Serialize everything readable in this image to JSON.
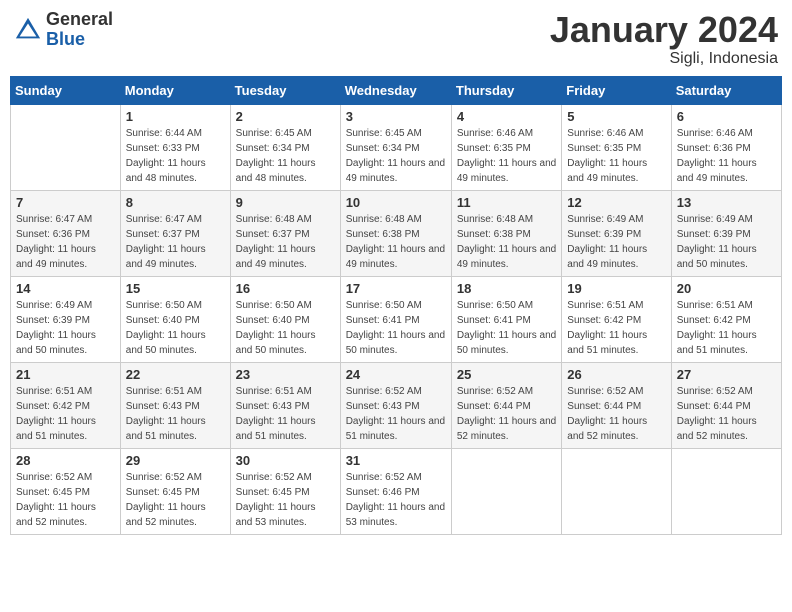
{
  "header": {
    "logo_general": "General",
    "logo_blue": "Blue",
    "month_year": "January 2024",
    "location": "Sigli, Indonesia"
  },
  "weekdays": [
    "Sunday",
    "Monday",
    "Tuesday",
    "Wednesday",
    "Thursday",
    "Friday",
    "Saturday"
  ],
  "weeks": [
    [
      {
        "day": "",
        "sunrise": "",
        "sunset": "",
        "daylight": ""
      },
      {
        "day": "1",
        "sunrise": "Sunrise: 6:44 AM",
        "sunset": "Sunset: 6:33 PM",
        "daylight": "Daylight: 11 hours and 48 minutes."
      },
      {
        "day": "2",
        "sunrise": "Sunrise: 6:45 AM",
        "sunset": "Sunset: 6:34 PM",
        "daylight": "Daylight: 11 hours and 48 minutes."
      },
      {
        "day": "3",
        "sunrise": "Sunrise: 6:45 AM",
        "sunset": "Sunset: 6:34 PM",
        "daylight": "Daylight: 11 hours and 49 minutes."
      },
      {
        "day": "4",
        "sunrise": "Sunrise: 6:46 AM",
        "sunset": "Sunset: 6:35 PM",
        "daylight": "Daylight: 11 hours and 49 minutes."
      },
      {
        "day": "5",
        "sunrise": "Sunrise: 6:46 AM",
        "sunset": "Sunset: 6:35 PM",
        "daylight": "Daylight: 11 hours and 49 minutes."
      },
      {
        "day": "6",
        "sunrise": "Sunrise: 6:46 AM",
        "sunset": "Sunset: 6:36 PM",
        "daylight": "Daylight: 11 hours and 49 minutes."
      }
    ],
    [
      {
        "day": "7",
        "sunrise": "Sunrise: 6:47 AM",
        "sunset": "Sunset: 6:36 PM",
        "daylight": "Daylight: 11 hours and 49 minutes."
      },
      {
        "day": "8",
        "sunrise": "Sunrise: 6:47 AM",
        "sunset": "Sunset: 6:37 PM",
        "daylight": "Daylight: 11 hours and 49 minutes."
      },
      {
        "day": "9",
        "sunrise": "Sunrise: 6:48 AM",
        "sunset": "Sunset: 6:37 PM",
        "daylight": "Daylight: 11 hours and 49 minutes."
      },
      {
        "day": "10",
        "sunrise": "Sunrise: 6:48 AM",
        "sunset": "Sunset: 6:38 PM",
        "daylight": "Daylight: 11 hours and 49 minutes."
      },
      {
        "day": "11",
        "sunrise": "Sunrise: 6:48 AM",
        "sunset": "Sunset: 6:38 PM",
        "daylight": "Daylight: 11 hours and 49 minutes."
      },
      {
        "day": "12",
        "sunrise": "Sunrise: 6:49 AM",
        "sunset": "Sunset: 6:39 PM",
        "daylight": "Daylight: 11 hours and 49 minutes."
      },
      {
        "day": "13",
        "sunrise": "Sunrise: 6:49 AM",
        "sunset": "Sunset: 6:39 PM",
        "daylight": "Daylight: 11 hours and 50 minutes."
      }
    ],
    [
      {
        "day": "14",
        "sunrise": "Sunrise: 6:49 AM",
        "sunset": "Sunset: 6:39 PM",
        "daylight": "Daylight: 11 hours and 50 minutes."
      },
      {
        "day": "15",
        "sunrise": "Sunrise: 6:50 AM",
        "sunset": "Sunset: 6:40 PM",
        "daylight": "Daylight: 11 hours and 50 minutes."
      },
      {
        "day": "16",
        "sunrise": "Sunrise: 6:50 AM",
        "sunset": "Sunset: 6:40 PM",
        "daylight": "Daylight: 11 hours and 50 minutes."
      },
      {
        "day": "17",
        "sunrise": "Sunrise: 6:50 AM",
        "sunset": "Sunset: 6:41 PM",
        "daylight": "Daylight: 11 hours and 50 minutes."
      },
      {
        "day": "18",
        "sunrise": "Sunrise: 6:50 AM",
        "sunset": "Sunset: 6:41 PM",
        "daylight": "Daylight: 11 hours and 50 minutes."
      },
      {
        "day": "19",
        "sunrise": "Sunrise: 6:51 AM",
        "sunset": "Sunset: 6:42 PM",
        "daylight": "Daylight: 11 hours and 51 minutes."
      },
      {
        "day": "20",
        "sunrise": "Sunrise: 6:51 AM",
        "sunset": "Sunset: 6:42 PM",
        "daylight": "Daylight: 11 hours and 51 minutes."
      }
    ],
    [
      {
        "day": "21",
        "sunrise": "Sunrise: 6:51 AM",
        "sunset": "Sunset: 6:42 PM",
        "daylight": "Daylight: 11 hours and 51 minutes."
      },
      {
        "day": "22",
        "sunrise": "Sunrise: 6:51 AM",
        "sunset": "Sunset: 6:43 PM",
        "daylight": "Daylight: 11 hours and 51 minutes."
      },
      {
        "day": "23",
        "sunrise": "Sunrise: 6:51 AM",
        "sunset": "Sunset: 6:43 PM",
        "daylight": "Daylight: 11 hours and 51 minutes."
      },
      {
        "day": "24",
        "sunrise": "Sunrise: 6:52 AM",
        "sunset": "Sunset: 6:43 PM",
        "daylight": "Daylight: 11 hours and 51 minutes."
      },
      {
        "day": "25",
        "sunrise": "Sunrise: 6:52 AM",
        "sunset": "Sunset: 6:44 PM",
        "daylight": "Daylight: 11 hours and 52 minutes."
      },
      {
        "day": "26",
        "sunrise": "Sunrise: 6:52 AM",
        "sunset": "Sunset: 6:44 PM",
        "daylight": "Daylight: 11 hours and 52 minutes."
      },
      {
        "day": "27",
        "sunrise": "Sunrise: 6:52 AM",
        "sunset": "Sunset: 6:44 PM",
        "daylight": "Daylight: 11 hours and 52 minutes."
      }
    ],
    [
      {
        "day": "28",
        "sunrise": "Sunrise: 6:52 AM",
        "sunset": "Sunset: 6:45 PM",
        "daylight": "Daylight: 11 hours and 52 minutes."
      },
      {
        "day": "29",
        "sunrise": "Sunrise: 6:52 AM",
        "sunset": "Sunset: 6:45 PM",
        "daylight": "Daylight: 11 hours and 52 minutes."
      },
      {
        "day": "30",
        "sunrise": "Sunrise: 6:52 AM",
        "sunset": "Sunset: 6:45 PM",
        "daylight": "Daylight: 11 hours and 53 minutes."
      },
      {
        "day": "31",
        "sunrise": "Sunrise: 6:52 AM",
        "sunset": "Sunset: 6:46 PM",
        "daylight": "Daylight: 11 hours and 53 minutes."
      },
      {
        "day": "",
        "sunrise": "",
        "sunset": "",
        "daylight": ""
      },
      {
        "day": "",
        "sunrise": "",
        "sunset": "",
        "daylight": ""
      },
      {
        "day": "",
        "sunrise": "",
        "sunset": "",
        "daylight": ""
      }
    ]
  ]
}
